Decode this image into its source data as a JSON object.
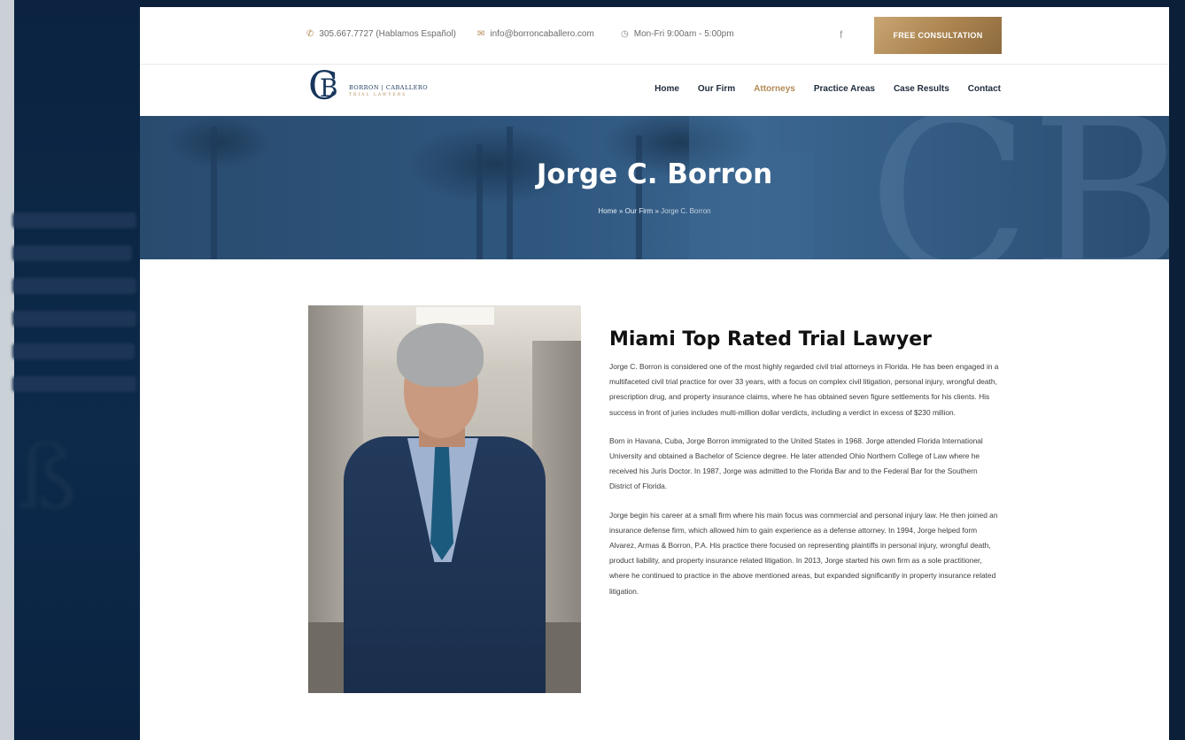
{
  "topbar": {
    "phone": "305.667.7727 (Hablamos Español)",
    "email": "info@borroncaballero.com",
    "hours": "Mon-Fri 9:00am - 5:00pm",
    "facebook": "f",
    "cta": "FREE CONSULTATION"
  },
  "logo": {
    "line1": "BORRON | CABALLERO",
    "line2": "TRIAL LAWYERS"
  },
  "nav": {
    "items": [
      "Home",
      "Our Firm",
      "Attorneys",
      "Practice Areas",
      "Case Results",
      "Contact"
    ],
    "active": "Attorneys"
  },
  "hero": {
    "title": "Jorge C. Borron",
    "breadcrumb": [
      "Home",
      "Our Firm",
      "Jorge C. Borron"
    ],
    "separator": " » "
  },
  "bio": {
    "heading": "Miami Top Rated Trial Lawyer",
    "paragraphs": [
      "Jorge C. Borron is considered one of the most highly regarded civil trial attorneys in Florida.  He has been engaged in a multifaceted civil trial practice for over 33 years, with a focus on complex civil litigation, personal injury, wrongful death, prescription drug, and property insurance claims, where he has obtained seven figure settlements for his clients.  His success in front of juries includes multi-million dollar verdicts, including a verdict in excess of $230 million.",
      "Born in Havana, Cuba, Jorge Borron immigrated to the United States in 1968. Jorge attended Florida International University and obtained a Bachelor of Science degree. He later attended Ohio Northern College of Law where he received his Juris Doctor.  In 1987, Jorge was admitted to the Florida Bar and to the Federal Bar for the Southern District of Florida.",
      "Jorge begin his career at a small firm where his main focus was commercial and personal injury law.  He then joined an insurance defense firm, which allowed him to gain experience as a defense attorney.  In 1994, Jorge helped form Alvarez, Armas & Borron, P.A.  His practice there focused on representing plaintiffs in personal injury, wrongful death, product liability, and property insurance related litigation.  In 2013, Jorge started his own firm as a sole practitioner, where he continued to practice in the above mentioned areas, but expanded significantly in property insurance related litigation."
    ]
  },
  "colors": {
    "accent": "#b38a56",
    "navy": "#18365c",
    "hero": "#2f577f"
  }
}
